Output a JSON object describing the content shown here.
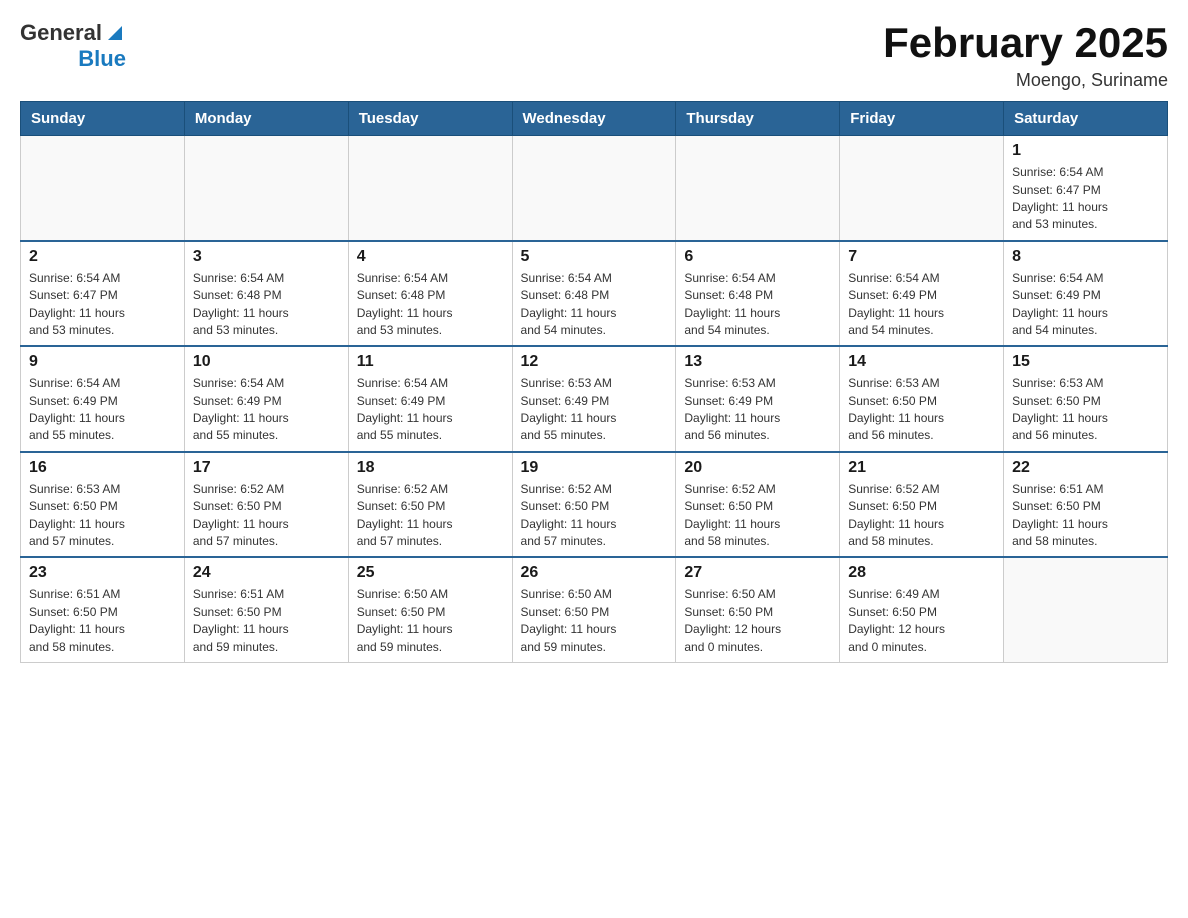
{
  "header": {
    "logo_general": "General",
    "logo_blue": "Blue",
    "main_title": "February 2025",
    "subtitle": "Moengo, Suriname"
  },
  "weekdays": [
    "Sunday",
    "Monday",
    "Tuesday",
    "Wednesday",
    "Thursday",
    "Friday",
    "Saturday"
  ],
  "weeks": [
    {
      "days": [
        {
          "num": "",
          "info": ""
        },
        {
          "num": "",
          "info": ""
        },
        {
          "num": "",
          "info": ""
        },
        {
          "num": "",
          "info": ""
        },
        {
          "num": "",
          "info": ""
        },
        {
          "num": "",
          "info": ""
        },
        {
          "num": "1",
          "info": "Sunrise: 6:54 AM\nSunset: 6:47 PM\nDaylight: 11 hours\nand 53 minutes."
        }
      ]
    },
    {
      "days": [
        {
          "num": "2",
          "info": "Sunrise: 6:54 AM\nSunset: 6:47 PM\nDaylight: 11 hours\nand 53 minutes."
        },
        {
          "num": "3",
          "info": "Sunrise: 6:54 AM\nSunset: 6:48 PM\nDaylight: 11 hours\nand 53 minutes."
        },
        {
          "num": "4",
          "info": "Sunrise: 6:54 AM\nSunset: 6:48 PM\nDaylight: 11 hours\nand 53 minutes."
        },
        {
          "num": "5",
          "info": "Sunrise: 6:54 AM\nSunset: 6:48 PM\nDaylight: 11 hours\nand 54 minutes."
        },
        {
          "num": "6",
          "info": "Sunrise: 6:54 AM\nSunset: 6:48 PM\nDaylight: 11 hours\nand 54 minutes."
        },
        {
          "num": "7",
          "info": "Sunrise: 6:54 AM\nSunset: 6:49 PM\nDaylight: 11 hours\nand 54 minutes."
        },
        {
          "num": "8",
          "info": "Sunrise: 6:54 AM\nSunset: 6:49 PM\nDaylight: 11 hours\nand 54 minutes."
        }
      ]
    },
    {
      "days": [
        {
          "num": "9",
          "info": "Sunrise: 6:54 AM\nSunset: 6:49 PM\nDaylight: 11 hours\nand 55 minutes."
        },
        {
          "num": "10",
          "info": "Sunrise: 6:54 AM\nSunset: 6:49 PM\nDaylight: 11 hours\nand 55 minutes."
        },
        {
          "num": "11",
          "info": "Sunrise: 6:54 AM\nSunset: 6:49 PM\nDaylight: 11 hours\nand 55 minutes."
        },
        {
          "num": "12",
          "info": "Sunrise: 6:53 AM\nSunset: 6:49 PM\nDaylight: 11 hours\nand 55 minutes."
        },
        {
          "num": "13",
          "info": "Sunrise: 6:53 AM\nSunset: 6:49 PM\nDaylight: 11 hours\nand 56 minutes."
        },
        {
          "num": "14",
          "info": "Sunrise: 6:53 AM\nSunset: 6:50 PM\nDaylight: 11 hours\nand 56 minutes."
        },
        {
          "num": "15",
          "info": "Sunrise: 6:53 AM\nSunset: 6:50 PM\nDaylight: 11 hours\nand 56 minutes."
        }
      ]
    },
    {
      "days": [
        {
          "num": "16",
          "info": "Sunrise: 6:53 AM\nSunset: 6:50 PM\nDaylight: 11 hours\nand 57 minutes."
        },
        {
          "num": "17",
          "info": "Sunrise: 6:52 AM\nSunset: 6:50 PM\nDaylight: 11 hours\nand 57 minutes."
        },
        {
          "num": "18",
          "info": "Sunrise: 6:52 AM\nSunset: 6:50 PM\nDaylight: 11 hours\nand 57 minutes."
        },
        {
          "num": "19",
          "info": "Sunrise: 6:52 AM\nSunset: 6:50 PM\nDaylight: 11 hours\nand 57 minutes."
        },
        {
          "num": "20",
          "info": "Sunrise: 6:52 AM\nSunset: 6:50 PM\nDaylight: 11 hours\nand 58 minutes."
        },
        {
          "num": "21",
          "info": "Sunrise: 6:52 AM\nSunset: 6:50 PM\nDaylight: 11 hours\nand 58 minutes."
        },
        {
          "num": "22",
          "info": "Sunrise: 6:51 AM\nSunset: 6:50 PM\nDaylight: 11 hours\nand 58 minutes."
        }
      ]
    },
    {
      "days": [
        {
          "num": "23",
          "info": "Sunrise: 6:51 AM\nSunset: 6:50 PM\nDaylight: 11 hours\nand 58 minutes."
        },
        {
          "num": "24",
          "info": "Sunrise: 6:51 AM\nSunset: 6:50 PM\nDaylight: 11 hours\nand 59 minutes."
        },
        {
          "num": "25",
          "info": "Sunrise: 6:50 AM\nSunset: 6:50 PM\nDaylight: 11 hours\nand 59 minutes."
        },
        {
          "num": "26",
          "info": "Sunrise: 6:50 AM\nSunset: 6:50 PM\nDaylight: 11 hours\nand 59 minutes."
        },
        {
          "num": "27",
          "info": "Sunrise: 6:50 AM\nSunset: 6:50 PM\nDaylight: 12 hours\nand 0 minutes."
        },
        {
          "num": "28",
          "info": "Sunrise: 6:49 AM\nSunset: 6:50 PM\nDaylight: 12 hours\nand 0 minutes."
        },
        {
          "num": "",
          "info": ""
        }
      ]
    }
  ]
}
